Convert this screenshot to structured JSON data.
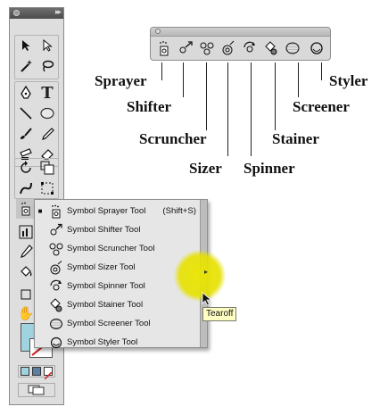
{
  "symbol_toolbar": {
    "tools": [
      {
        "name": "Sprayer"
      },
      {
        "name": "Shifter"
      },
      {
        "name": "Scruncher"
      },
      {
        "name": "Sizer"
      },
      {
        "name": "Spinner"
      },
      {
        "name": "Stainer"
      },
      {
        "name": "Screener"
      },
      {
        "name": "Styler"
      }
    ]
  },
  "callouts": {
    "sprayer": "Sprayer",
    "shifter": "Shifter",
    "scruncher": "Scruncher",
    "sizer": "Sizer",
    "spinner": "Spinner",
    "stainer": "Stainer",
    "screener": "Screener",
    "styler": "Styler"
  },
  "flyout": {
    "items": [
      {
        "label": "Symbol Sprayer Tool",
        "shortcut": "(Shift+S)",
        "selected": true
      },
      {
        "label": "Symbol Shifter Tool",
        "shortcut": ""
      },
      {
        "label": "Symbol Scruncher Tool",
        "shortcut": ""
      },
      {
        "label": "Symbol Sizer Tool",
        "shortcut": ""
      },
      {
        "label": "Symbol Spinner Tool",
        "shortcut": ""
      },
      {
        "label": "Symbol Stainer Tool",
        "shortcut": ""
      },
      {
        "label": "Symbol Screener Tool",
        "shortcut": ""
      },
      {
        "label": "Symbol Styler Tool",
        "shortcut": ""
      }
    ],
    "selected_marker": "■"
  },
  "tooltip": "Tearoff",
  "toolbox": {
    "glyphs": {
      "selection": "➤",
      "direct_selection": "➢",
      "type": "T",
      "hand": "✋"
    },
    "colors": {
      "fill": "#9fd3e0",
      "stroke_none": "#d11a1a"
    }
  },
  "colors": {
    "highlight": "#e6e100",
    "tooltip_bg": "#ffffc4",
    "panel": "#dedede"
  }
}
